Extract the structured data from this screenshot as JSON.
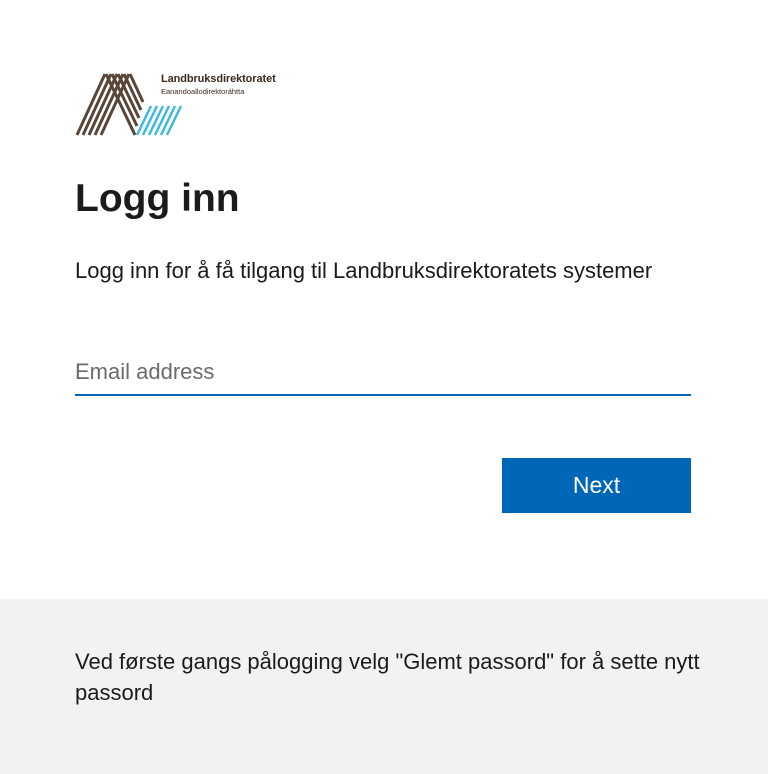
{
  "brand": {
    "name": "Landbruksdirektoratet",
    "subtitle": "Eanandoallodirektoráhtta",
    "colors": {
      "brown": "#5a4638",
      "blue": "#3ab7e6"
    }
  },
  "login": {
    "title": "Logg inn",
    "description": "Logg inn for å få tilgang til Landbruksdirektoratets systemer",
    "email_placeholder": "Email address",
    "email_value": "",
    "next_label": "Next"
  },
  "footer": {
    "text": "Ved første gangs pålogging velg \"Glemt passord\" for å sette nytt passord"
  },
  "colors": {
    "accent": "#0067b8",
    "footer_bg": "#f2f2f2",
    "text": "#1b1b1b"
  }
}
